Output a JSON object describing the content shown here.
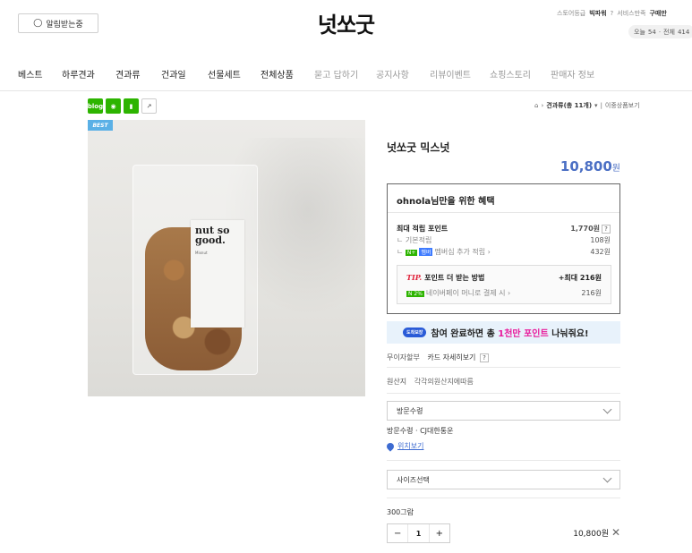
{
  "header": {
    "notify_label": "알림받는중",
    "logo": "넛쏘굿",
    "store_grade_label": "스토어등급",
    "store_grade": "빅파워",
    "service_label": "서비스만족",
    "purchase_label": "구매만",
    "today_label": "오늘",
    "today_count": "54",
    "total_label": "전체",
    "total_count": "414"
  },
  "nav": {
    "items": [
      {
        "label": "베스트"
      },
      {
        "label": "하루견과"
      },
      {
        "label": "견과류"
      },
      {
        "label": "건과일"
      },
      {
        "label": "선물세트"
      },
      {
        "label": "전체상품"
      },
      {
        "label": "묻고 답하기"
      },
      {
        "label": "공지사항"
      },
      {
        "label": "리뷰이벤트"
      },
      {
        "label": "쇼핑스토리"
      },
      {
        "label": "판매자 정보"
      }
    ]
  },
  "share": {
    "icons": [
      "blog-icon",
      "talk-icon",
      "bookmark-icon",
      "share-icon"
    ],
    "blog_label": "blog"
  },
  "breadcrumb": {
    "category": "견과류(총 11개)",
    "view": "이중상품보기"
  },
  "product": {
    "best_badge": "BEST",
    "package_brand": "nut so good.",
    "package_sub": "Mixnut",
    "title": "넛쏘굿 믹스넛",
    "price": "10,800",
    "currency": "원"
  },
  "benefit": {
    "heading": "ohnola님만을 위한 혜택",
    "max_points_label": "최대 적립 포인트",
    "max_points_value": "1,770원",
    "basic_label": "기본적립",
    "basic_value": "108원",
    "membership_label": "멤버십 추가 적립",
    "membership_value": "432원",
    "tip_label": "TIP.",
    "tip_text": "포인트 더 받는 방법",
    "tip_value": "+최대 216원",
    "npay_label": "네이버페이 머니로 결제 시",
    "npay_value": "216원"
  },
  "banner": {
    "pill": "도착보장",
    "text_a": "참여 완료하면 총 ",
    "text_hl": "1천만 포인트",
    "text_b": " 나눠줘요!"
  },
  "info": {
    "installment_label": "무이자할부",
    "installment_link": "카드 자세히보기",
    "origin_label": "원산지",
    "origin_value": "각각의원산지에따름",
    "delivery_select": "방문수령",
    "delivery_detail": "방문수령 · CJ대한통운",
    "map_link": "위치보기",
    "size_select": "사이즈선택",
    "option_name": "300그람",
    "quantity": "1",
    "line_price": "10,800",
    "line_currency": "원"
  }
}
